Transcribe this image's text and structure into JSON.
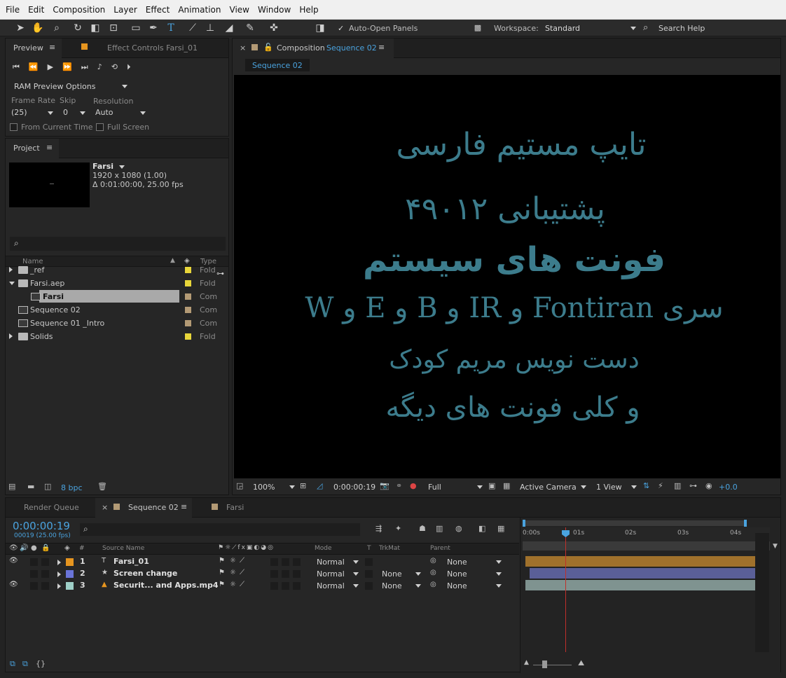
{
  "menubar": [
    "File",
    "Edit",
    "Composition",
    "Layer",
    "Effect",
    "Animation",
    "View",
    "Window",
    "Help"
  ],
  "toolbar": {
    "auto_open_panels": "Auto-Open Panels",
    "workspace_label": "Workspace:",
    "workspace_value": "Standard",
    "search_help": "Search Help"
  },
  "preview_panel": {
    "tab": "Preview",
    "effect_controls_tab": "Effect Controls  Farsi_01",
    "ram_preview": "RAM Preview Options",
    "frame_rate_label": "Frame Rate",
    "skip_label": "Skip",
    "resolution_label": "Resolution",
    "frame_rate_value": "(25)",
    "skip_value": "0",
    "resolution_value": "Auto",
    "from_current_time": "From Current Time",
    "full_screen": "Full Screen"
  },
  "project_panel": {
    "tab": "Project",
    "selected_name": "Farsi",
    "selected_dims": "1920 x 1080 (1.00)",
    "selected_duration": "Δ 0:01:00:00, 25.00 fps",
    "col_name": "Name",
    "col_type": "Type",
    "items": [
      {
        "name": "_ref",
        "type": "Fold",
        "kind": "folder",
        "color": "#e8d63a",
        "indent": 0,
        "twirl": "right"
      },
      {
        "name": "Farsi.aep",
        "type": "Fold",
        "kind": "folder",
        "color": "#e8d63a",
        "indent": 0,
        "twirl": "down"
      },
      {
        "name": "Farsi",
        "type": "Com",
        "kind": "comp",
        "color": "#b39a75",
        "indent": 1,
        "twirl": "none",
        "selected": true
      },
      {
        "name": "Sequence 02",
        "type": "Com",
        "kind": "comp",
        "color": "#b39a75",
        "indent": 0,
        "twirl": "none"
      },
      {
        "name": "Sequence 01 _Intro",
        "type": "Com",
        "kind": "comp",
        "color": "#b39a75",
        "indent": 0,
        "twirl": "none"
      },
      {
        "name": "Solids",
        "type": "Fold",
        "kind": "folder",
        "color": "#e8d63a",
        "indent": 0,
        "twirl": "right"
      }
    ],
    "bpc": "8 bpc"
  },
  "composition_panel": {
    "tab_label": "Composition",
    "tab_name": "Sequence 02",
    "chip": "Sequence 02",
    "text_lines": [
      "تایپ مستیم فارسی",
      "پشتیبانی ۴۹۰۱۲",
      "فونت های سیستم",
      "سری Fontiran و IR و B و E و W",
      "دست نویس مریم کودک",
      "و کلی فونت های دیگه"
    ],
    "text_color": "#3c7c8c",
    "zoom": "100%",
    "timecode": "0:00:00:19",
    "resolution": "Full",
    "camera": "Active Camera",
    "views": "1 View",
    "exposure": "+0.0"
  },
  "timeline": {
    "tabs": [
      "Render Queue",
      "Sequence 02",
      "Farsi"
    ],
    "timecode": "0:00:00:19",
    "frame_info": "00019 (25.00 fps)",
    "col_source": "Source Name",
    "col_mode": "Mode",
    "col_t": "T",
    "col_trkmat": "TrkMat",
    "col_parent": "Parent",
    "ruler": [
      "0:00s",
      "01s",
      "02s",
      "03s",
      "04s"
    ],
    "layers": [
      {
        "num": "1",
        "name": "Farsi_01",
        "mode": "Normal",
        "trkmat": "",
        "parent": "None",
        "color": "#e6951f",
        "bar": "#a0712c"
      },
      {
        "num": "2",
        "name": "Screen change",
        "mode": "Normal",
        "trkmat": "None",
        "parent": "None",
        "color": "#6a74d8",
        "bar": "#5a5f97"
      },
      {
        "num": "3",
        "name": "Securit... and Apps.mp4",
        "mode": "Normal",
        "trkmat": "None",
        "parent": "None",
        "color": "#9fd0c8",
        "bar": "#7f9390"
      }
    ]
  }
}
